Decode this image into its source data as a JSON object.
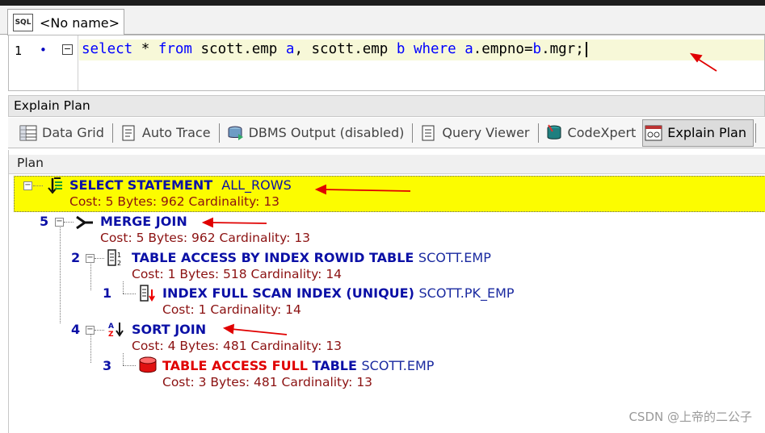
{
  "tab": {
    "icon": "sql-file-icon",
    "icon_text": "SQL",
    "label": "<No name>"
  },
  "editor": {
    "line_number": "1",
    "bullet": "•",
    "fold": "⊟",
    "tokens": [
      "select",
      " * ",
      "from",
      " scott.emp ",
      "a",
      ", scott.emp ",
      "b",
      " ",
      "where",
      " ",
      "a",
      ".empno=",
      "b",
      ".mgr;"
    ]
  },
  "panel": {
    "title": "Explain Plan"
  },
  "toolbar": {
    "items": [
      {
        "label": "Data Grid",
        "icon": "grid-icon"
      },
      {
        "label": "Auto Trace",
        "icon": "trace-icon"
      },
      {
        "label": "DBMS Output (disabled)",
        "icon": "dbms-output-icon"
      },
      {
        "label": "Query Viewer",
        "icon": "query-viewer-icon"
      },
      {
        "label": "CodeXpert",
        "icon": "codexpert-icon"
      },
      {
        "label": "Explain Plan",
        "icon": "explain-plan-icon"
      }
    ]
  },
  "plan": {
    "header": "Plan",
    "nodes": [
      {
        "id": "",
        "title": "SELECT STATEMENT",
        "sub": "ALL_ROWS",
        "object": "",
        "stats": "Cost: 5  Bytes: 962  Cardinality: 13"
      },
      {
        "id": "5",
        "title": "MERGE JOIN",
        "sub": "",
        "object": "",
        "stats": "Cost: 5  Bytes: 962  Cardinality: 13"
      },
      {
        "id": "2",
        "title": "TABLE ACCESS BY INDEX ROWID TABLE",
        "sub": "",
        "object": "SCOTT.EMP",
        "stats": "Cost: 1  Bytes: 518  Cardinality: 14"
      },
      {
        "id": "1",
        "title": "INDEX FULL SCAN INDEX (UNIQUE)",
        "sub": "",
        "object": "SCOTT.PK_EMP",
        "stats": "Cost: 1  Cardinality: 14"
      },
      {
        "id": "4",
        "title": "SORT JOIN",
        "sub": "",
        "object": "",
        "stats": "Cost: 4  Bytes: 481  Cardinality: 13"
      },
      {
        "id": "3",
        "title_red": "TABLE ACCESS FULL",
        "title": "TABLE",
        "sub": "",
        "object": "SCOTT.EMP",
        "stats": "Cost: 3  Bytes: 481  Cardinality: 13"
      }
    ]
  },
  "watermark": "CSDN @上帝的二公子",
  "colors": {
    "highlight": "#fcfc00",
    "keyword": "#0000ff",
    "node_title": "#0b10a6",
    "stats": "#8b1111",
    "annotation_arrow": "#e00000"
  }
}
